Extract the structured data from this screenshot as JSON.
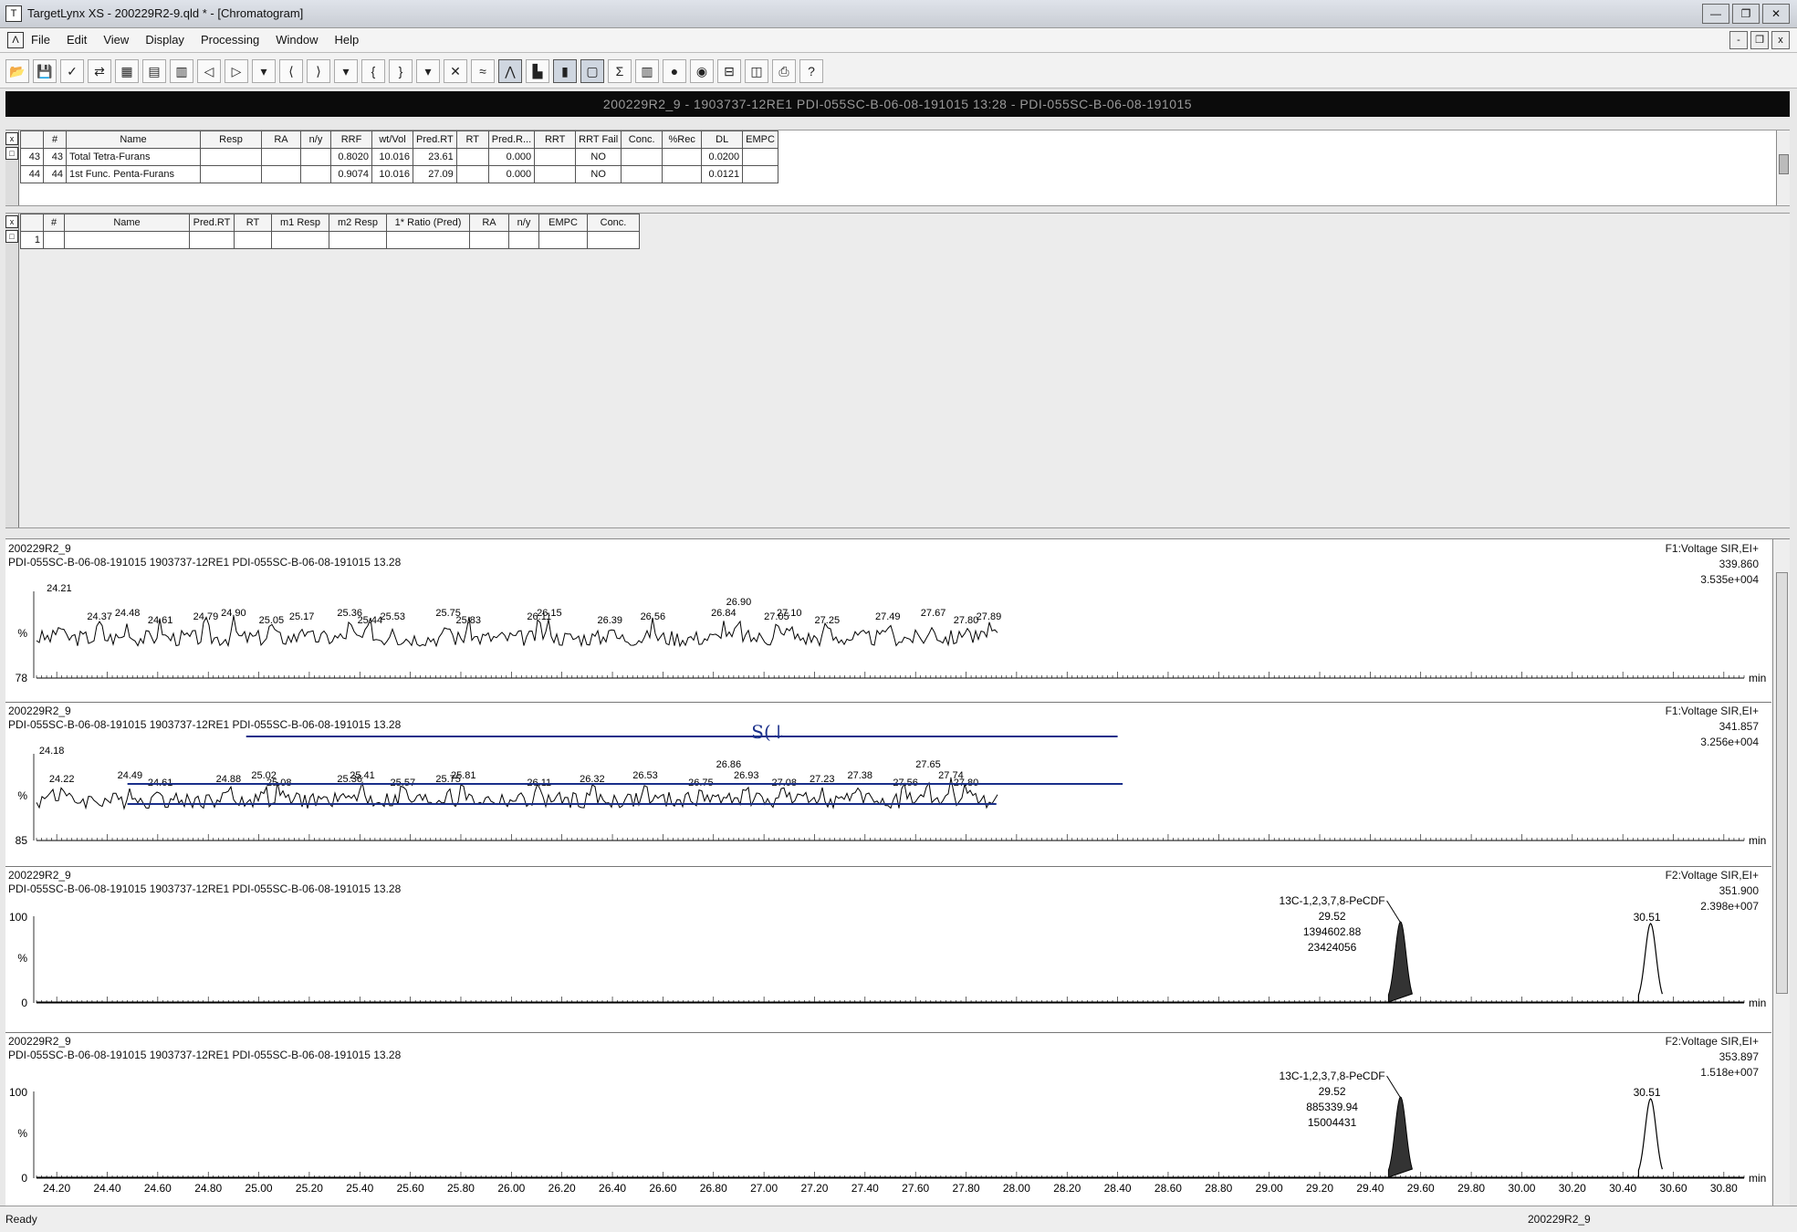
{
  "window": {
    "title": "TargetLynx XS - 200229R2-9.qld * - [Chromatogram]",
    "app_icon": "T",
    "controls": [
      "—",
      "❐",
      "✕"
    ]
  },
  "menubar": {
    "mdi_icon": "Λ",
    "items": [
      "File",
      "Edit",
      "View",
      "Display",
      "Processing",
      "Window",
      "Help"
    ],
    "mdi_controls": [
      "-",
      "❐",
      "x"
    ]
  },
  "toolbar": {
    "icons": [
      "open-icon",
      "save-icon",
      "check-icon",
      "compare-icon",
      "grid-icon",
      "report-icon",
      "report2-icon",
      "prev-icon",
      "next-icon",
      "dropdown-icon",
      "zoom-prev-icon",
      "zoom-next-icon",
      "dropdown-icon",
      "integrate-left-icon",
      "integrate-right-icon",
      "dropdown-icon",
      "scale-icon",
      "chart-icon",
      "chromatogram-icon",
      "spectrum-icon",
      "bar-icon",
      "layout1-icon",
      "layout2-icon",
      "layout3-icon",
      "peak-icon",
      "sample-icon",
      "split-h-icon",
      "split-v-icon",
      "print-icon",
      "help-icon"
    ],
    "glyphs": [
      "📂",
      "💾",
      "✓",
      "⇄",
      "▦",
      "▤",
      "▥",
      "◁",
      "▷",
      "▾",
      "⟨",
      "⟩",
      "▾",
      "{",
      "}",
      "▾",
      "✕",
      "≈",
      "⋀",
      "▙",
      "▮",
      "▢",
      "Σ",
      "▥",
      "●",
      "◉",
      "⊟",
      "◫",
      "⎙",
      "?"
    ]
  },
  "info_bar": "200229R2_9 - 1903737-12RE1 PDI-055SC-B-06-08-191015 13:28 - PDI-055SC-B-06-08-191015",
  "compound_table": {
    "side": [
      "x",
      "□"
    ],
    "headers": [
      "",
      "#",
      "Name",
      "Resp",
      "RA",
      "n/y",
      "RRF",
      "wt/Vol",
      "Pred.RT",
      "RT",
      "Pred.R...",
      "RRT",
      "RRT Fail",
      "Conc.",
      "%Rec",
      "DL",
      "EMPC"
    ],
    "rows": [
      [
        "43",
        "43",
        "Total Tetra-Furans",
        "",
        "",
        "",
        "0.8020",
        "10.016",
        "23.61",
        "",
        "0.000",
        "",
        "NO",
        "",
        "",
        "0.0200",
        ""
      ],
      [
        "44",
        "44",
        "1st Func. Penta-Furans",
        "",
        "",
        "",
        "0.9074",
        "10.016",
        "27.09",
        "",
        "0.000",
        "",
        "NO",
        "",
        "",
        "0.0121",
        ""
      ]
    ]
  },
  "peak_table": {
    "side": [
      "x",
      "□"
    ],
    "headers": [
      "",
      "#",
      "Name",
      "Pred.RT",
      "RT",
      "m1 Resp",
      "m2 Resp",
      "1* Ratio (Pred)",
      "RA",
      "n/y",
      "EMPC",
      "Conc."
    ],
    "rows": [
      [
        "1",
        "",
        "",
        "",
        "",
        "",
        "",
        "",
        "",
        "",
        "",
        ""
      ]
    ]
  },
  "chromatograms": [
    {
      "sample": "200229R2_9",
      "description": "PDI-055SC-B-06-08-191015 1903737-12RE1 PDI-055SC-B-06-08-191015 13.28",
      "function": "F1:Voltage SIR,EI+",
      "mass": "339.860",
      "intensity": "3.535e+004",
      "y_top_label": "",
      "y_mid_label": "%",
      "y_bottom_label": "78",
      "x_unit": "min",
      "peak_labels": [
        "24.21",
        "24.37",
        "24.48",
        "24.61",
        "24.79",
        "24.90",
        "25.05",
        "25.17",
        "25.36",
        "25.44",
        "25.53",
        "25.75",
        "25.83",
        "26.11",
        "26.15",
        "26.39",
        "26.56",
        "26.84",
        "26.90",
        "27.05",
        "27.10",
        "27.25",
        "27.49",
        "27.67",
        "27.80",
        "27.89"
      ]
    },
    {
      "sample": "200229R2_9",
      "description": "PDI-055SC-B-06-08-191015 1903737-12RE1 PDI-055SC-B-06-08-191015 13.28",
      "function": "F1:Voltage SIR,EI+",
      "mass": "341.857",
      "intensity": "3.256e+004",
      "y_top_label": "",
      "y_mid_label": "%",
      "y_bottom_label": "85",
      "x_unit": "min",
      "handwritten_note": "S(↓",
      "peak_labels": [
        "24.18",
        "24.22",
        "24.49",
        "24.61",
        "24.88",
        "25.02",
        "25.08",
        "25.36",
        "25.41",
        "25.57",
        "25.75",
        "25.81",
        "26.11",
        "26.32",
        "26.53",
        "26.75",
        "26.86",
        "26.93",
        "27.08",
        "27.23",
        "27.38",
        "27.56",
        "27.65",
        "27.74",
        "27.80"
      ]
    },
    {
      "sample": "200229R2_9",
      "description": "PDI-055SC-B-06-08-191015 1903737-12RE1 PDI-055SC-B-06-08-191015 13.28",
      "function": "F2:Voltage SIR,EI+",
      "mass": "351.900",
      "intensity": "2.398e+007",
      "y_top_label": "100",
      "y_mid_label": "%",
      "y_bottom_label": "0",
      "x_unit": "min",
      "peak_annotation": {
        "name": "13C-1,2,3,7,8-PeCDF",
        "rt": "29.52",
        "area": "1394602.88",
        "height": "23424056"
      },
      "second_peak": "30.51"
    },
    {
      "sample": "200229R2_9",
      "description": "PDI-055SC-B-06-08-191015 1903737-12RE1 PDI-055SC-B-06-08-191015 13.28",
      "function": "F2:Voltage SIR,EI+",
      "mass": "353.897",
      "intensity": "1.518e+007",
      "y_top_label": "100",
      "y_mid_label": "%",
      "y_bottom_label": "0",
      "x_unit": "min",
      "peak_annotation": {
        "name": "13C-1,2,3,7,8-PeCDF",
        "rt": "29.52",
        "area": "885339.94",
        "height": "15004431"
      },
      "second_peak": "30.51"
    }
  ],
  "x_axis": {
    "min": 24.12,
    "max": 30.88,
    "ticks": [
      "24.20",
      "24.40",
      "24.60",
      "24.80",
      "25.00",
      "25.20",
      "25.40",
      "25.60",
      "25.80",
      "26.00",
      "26.20",
      "26.40",
      "26.60",
      "26.80",
      "27.00",
      "27.20",
      "27.40",
      "27.60",
      "27.80",
      "28.00",
      "28.20",
      "28.40",
      "28.60",
      "28.80",
      "29.00",
      "29.20",
      "29.40",
      "29.60",
      "29.80",
      "30.00",
      "30.20",
      "30.40",
      "30.60",
      "30.80"
    ]
  },
  "status": {
    "ready": "Ready",
    "document": "200229R2_9"
  },
  "colors": {
    "trace": "#000000",
    "annotation_pen": "#1a2f8a",
    "info_bar": "#0b0b0b"
  }
}
